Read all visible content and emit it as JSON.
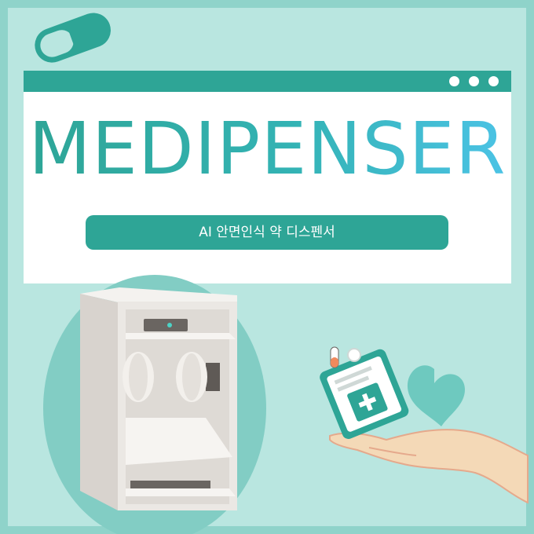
{
  "header": {
    "title": "MEDIPENSER",
    "subtitle": "AI 안면인식 약 디스펜서"
  },
  "icons": [
    "pill-capsule-icon",
    "window-dots-icon",
    "medicine-card-icon",
    "heart-icon",
    "hand-icon",
    "dispenser-machine"
  ],
  "colors": {
    "background": "#b9e6e0",
    "frame": "#8fd3ca",
    "accent": "#2ea596",
    "title_gradient_end": "#4cc3e6"
  }
}
